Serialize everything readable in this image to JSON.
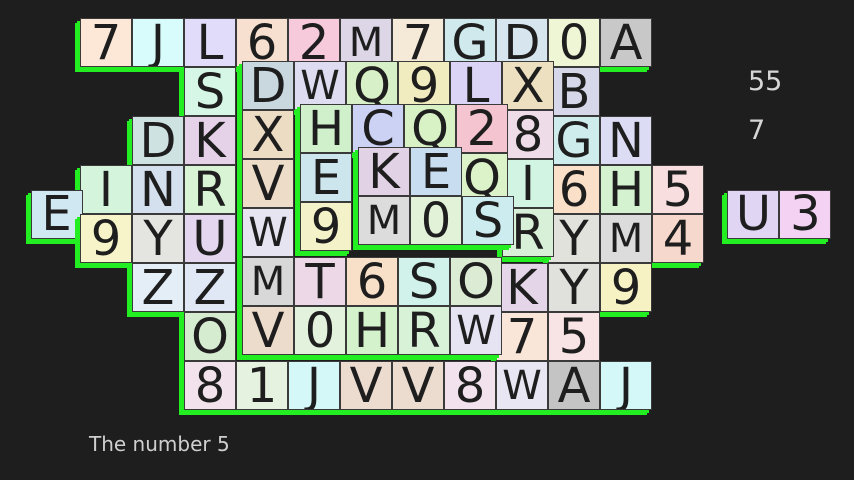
{
  "game": {
    "remaining_tiles": "55",
    "available_moves": "7",
    "hint_text": "The number 5"
  },
  "colors": {
    "background": "#1e1e1e",
    "tile_side": "#22ee22",
    "tile_text": "#1e1e1e"
  },
  "tiles": [
    {
      "ch": "7",
      "c": "#fde8d8",
      "g": [
        1,
        0,
        0
      ]
    },
    {
      "ch": "J",
      "c": "#d8fcfc",
      "g": [
        2,
        0,
        0
      ]
    },
    {
      "ch": "L",
      "c": "#e0dcfa",
      "g": [
        3,
        0,
        0
      ]
    },
    {
      "ch": "6",
      "c": "#f8e0d0",
      "g": [
        4,
        0,
        0
      ]
    },
    {
      "ch": "2",
      "c": "#f6cadb",
      "g": [
        5,
        0,
        0
      ]
    },
    {
      "ch": "M",
      "c": "#dcd6e6",
      "g": [
        6,
        0,
        0
      ]
    },
    {
      "ch": "7",
      "c": "#f5ead8",
      "g": [
        7,
        0,
        0
      ]
    },
    {
      "ch": "G",
      "c": "#cfe9ec",
      "g": [
        8,
        0,
        0
      ]
    },
    {
      "ch": "D",
      "c": "#d7e6ee",
      "g": [
        9,
        0,
        0
      ]
    },
    {
      "ch": "0",
      "c": "#eef6d6",
      "g": [
        10,
        0,
        0
      ]
    },
    {
      "ch": "A",
      "c": "#c8c8c8",
      "g": [
        11,
        0,
        0
      ]
    },
    {
      "ch": "S",
      "c": "#d6f6e6",
      "g": [
        3,
        1,
        0
      ]
    },
    {
      "ch": "D",
      "c": "#c8d8de",
      "g": [
        4,
        1,
        1
      ]
    },
    {
      "ch": "W",
      "c": "#dedcf0",
      "g": [
        5,
        1,
        1
      ]
    },
    {
      "ch": "Q",
      "c": "#d8f0c8",
      "g": [
        6,
        1,
        1
      ]
    },
    {
      "ch": "9",
      "c": "#f0ecc0",
      "g": [
        7,
        1,
        1
      ]
    },
    {
      "ch": "L",
      "c": "#dcd4f6",
      "g": [
        8,
        1,
        1
      ]
    },
    {
      "ch": "X",
      "c": "#ece0c0",
      "g": [
        9,
        1,
        1
      ]
    },
    {
      "ch": "B",
      "c": "#d6d8ea",
      "g": [
        10,
        1,
        0
      ]
    },
    {
      "ch": "D",
      "c": "#cfe2e2",
      "g": [
        2,
        2,
        0
      ]
    },
    {
      "ch": "K",
      "c": "#e6d2e8",
      "g": [
        3,
        2,
        0
      ]
    },
    {
      "ch": "X",
      "c": "#ecdcc4",
      "g": [
        4,
        2,
        1
      ]
    },
    {
      "ch": "H",
      "c": "#d0f0cc",
      "g": [
        5,
        2,
        2
      ]
    },
    {
      "ch": "C",
      "c": "#ccd2f4",
      "g": [
        6,
        2,
        2
      ]
    },
    {
      "ch": "Q",
      "c": "#d8f2c6",
      "g": [
        7,
        2,
        2
      ]
    },
    {
      "ch": "2",
      "c": "#f4c4d0",
      "g": [
        8,
        2,
        2
      ]
    },
    {
      "ch": "8",
      "c": "#eedde8",
      "g": [
        9,
        2,
        1
      ]
    },
    {
      "ch": "G",
      "c": "#cfeced",
      "g": [
        10,
        2,
        0
      ]
    },
    {
      "ch": "N",
      "c": "#dcdcf4",
      "g": [
        11,
        2,
        0
      ]
    },
    {
      "ch": "I",
      "c": "#d4f4dc",
      "g": [
        1,
        3,
        0
      ]
    },
    {
      "ch": "N",
      "c": "#d4e0ee",
      "g": [
        2,
        3,
        0
      ]
    },
    {
      "ch": "R",
      "c": "#d8f4d4",
      "g": [
        3,
        3,
        0
      ]
    },
    {
      "ch": "V",
      "c": "#ecdcc8",
      "g": [
        4,
        3,
        1
      ]
    },
    {
      "ch": "E",
      "c": "#cde6ee",
      "g": [
        5,
        3,
        2
      ]
    },
    {
      "ch": "K",
      "c": "#e2d2e6",
      "g": [
        6,
        3,
        3
      ]
    },
    {
      "ch": "E",
      "c": "#c8ddf0",
      "g": [
        7,
        3,
        3
      ]
    },
    {
      "ch": "Q",
      "c": "#dcf2c8",
      "g": [
        8,
        3,
        2
      ]
    },
    {
      "ch": "I",
      "c": "#d2f4e2",
      "g": [
        9,
        3,
        1
      ]
    },
    {
      "ch": "6",
      "c": "#fae0c8",
      "g": [
        10,
        3,
        0
      ]
    },
    {
      "ch": "H",
      "c": "#d4f2d0",
      "g": [
        11,
        3,
        0
      ]
    },
    {
      "ch": "5",
      "c": "#f8dede",
      "g": [
        12,
        3,
        0
      ]
    },
    {
      "ch": "U",
      "c": "#e0d6f4",
      "g": [
        13.45,
        3.5,
        0
      ]
    },
    {
      "ch": "3",
      "c": "#f4d2f4",
      "g": [
        14.45,
        3.5,
        0
      ]
    },
    {
      "ch": "E",
      "c": "#d0e8f2",
      "g": [
        0.05,
        3.5,
        0
      ]
    },
    {
      "ch": "9",
      "c": "#f6f4c8",
      "g": [
        1,
        4,
        0
      ]
    },
    {
      "ch": "Y",
      "c": "#e4e4e0",
      "g": [
        2,
        4,
        0
      ]
    },
    {
      "ch": "U",
      "c": "#e4d6ee",
      "g": [
        3,
        4,
        0
      ]
    },
    {
      "ch": "W",
      "c": "#e6e4f0",
      "g": [
        4,
        4,
        1
      ]
    },
    {
      "ch": "9",
      "c": "#f4f2c8",
      "g": [
        5,
        4,
        2
      ]
    },
    {
      "ch": "M",
      "c": "#dcdcdc",
      "g": [
        6,
        4,
        3
      ]
    },
    {
      "ch": "0",
      "c": "#e2f2d8",
      "g": [
        7,
        4,
        3
      ]
    },
    {
      "ch": "S",
      "c": "#ccecef",
      "g": [
        8,
        4,
        3
      ]
    },
    {
      "ch": "R",
      "c": "#d8efd8",
      "g": [
        9,
        4,
        1
      ]
    },
    {
      "ch": "Y",
      "c": "#e2e2dc",
      "g": [
        10,
        4,
        0
      ]
    },
    {
      "ch": "M",
      "c": "#dcdcdc",
      "g": [
        11,
        4,
        0
      ]
    },
    {
      "ch": "4",
      "c": "#f6d8cc",
      "g": [
        12,
        4,
        0
      ]
    },
    {
      "ch": "Z",
      "c": "#e4eef6",
      "g": [
        2,
        5,
        0
      ]
    },
    {
      "ch": "Z",
      "c": "#e0e8f6",
      "g": [
        3,
        5,
        0
      ]
    },
    {
      "ch": "M",
      "c": "#d8d8d8",
      "g": [
        4,
        5,
        1
      ]
    },
    {
      "ch": "T",
      "c": "#ecd8e6",
      "g": [
        5,
        5,
        1
      ]
    },
    {
      "ch": "6",
      "c": "#f8e0c8",
      "g": [
        6,
        5,
        1
      ]
    },
    {
      "ch": "S",
      "c": "#d0f2ea",
      "g": [
        7,
        5,
        1
      ]
    },
    {
      "ch": "O",
      "c": "#dcecd4",
      "g": [
        8,
        5,
        1
      ]
    },
    {
      "ch": "K",
      "c": "#e4d6e8",
      "g": [
        9,
        5,
        0
      ]
    },
    {
      "ch": "Y",
      "c": "#e0e0dc",
      "g": [
        10,
        5,
        0
      ]
    },
    {
      "ch": "9",
      "c": "#f6f2c4",
      "g": [
        11,
        5,
        0
      ]
    },
    {
      "ch": "O",
      "c": "#d6ecd0",
      "g": [
        3,
        6,
        0
      ]
    },
    {
      "ch": "V",
      "c": "#ecdccc",
      "g": [
        4,
        6,
        1
      ]
    },
    {
      "ch": "0",
      "c": "#e2f2dc",
      "g": [
        5,
        6,
        1
      ]
    },
    {
      "ch": "H",
      "c": "#d4f2cc",
      "g": [
        6,
        6,
        1
      ]
    },
    {
      "ch": "R",
      "c": "#d8f2d8",
      "g": [
        7,
        6,
        1
      ]
    },
    {
      "ch": "W",
      "c": "#e6e4f2",
      "g": [
        8,
        6,
        1
      ]
    },
    {
      "ch": "7",
      "c": "#fae6d8",
      "g": [
        9,
        6,
        0
      ]
    },
    {
      "ch": "5",
      "c": "#f8e4e4",
      "g": [
        10,
        6,
        0
      ]
    },
    {
      "ch": "8",
      "c": "#f2e2ec",
      "g": [
        3,
        7,
        0
      ]
    },
    {
      "ch": "1",
      "c": "#e6f2e0",
      "g": [
        4,
        7,
        0
      ]
    },
    {
      "ch": "J",
      "c": "#d4f8f8",
      "g": [
        5,
        7,
        0
      ]
    },
    {
      "ch": "V",
      "c": "#ecdcd0",
      "g": [
        6,
        7,
        0
      ]
    },
    {
      "ch": "V",
      "c": "#ecdcd0",
      "g": [
        7,
        7,
        0
      ]
    },
    {
      "ch": "8",
      "c": "#f2e2ee",
      "g": [
        8,
        7,
        0
      ]
    },
    {
      "ch": "W",
      "c": "#e8e6f2",
      "g": [
        9,
        7,
        0
      ]
    },
    {
      "ch": "A",
      "c": "#c4c4c4",
      "g": [
        10,
        7,
        0
      ]
    },
    {
      "ch": "J",
      "c": "#d4f8f8",
      "g": [
        11,
        7,
        0
      ]
    }
  ]
}
